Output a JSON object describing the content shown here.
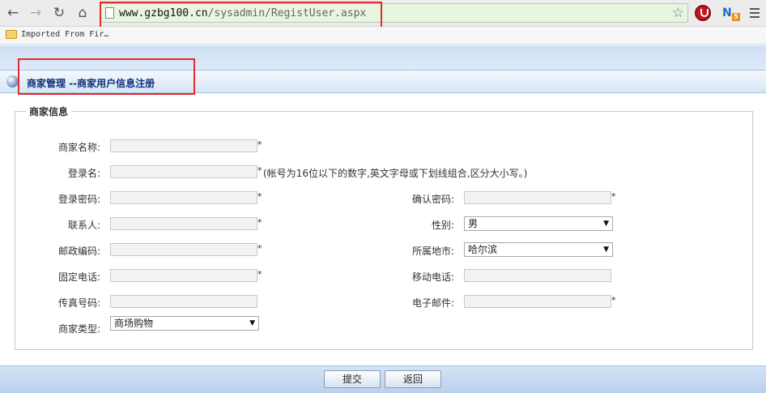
{
  "browser": {
    "url_host": "www.gzbg100.cn",
    "url_path": "/sysadmin/RegistUser.aspx",
    "bookmark_label": "Imported From Fir…",
    "back_icon": "←",
    "forward_icon": "→",
    "reload_icon": "↻",
    "home_icon": "⌂",
    "star_icon": "☆",
    "ext_badge": "5"
  },
  "page": {
    "title": "商家管理 --商家用户信息注册",
    "section_legend": "商家信息",
    "required_mark": "*",
    "select_arrow": "▼"
  },
  "form": {
    "name_label": "商家名称:",
    "login_label": "登录名:",
    "login_hint": "(帐号为16位以下的数字,英文字母或下划线组合,区分大小写。)",
    "password_label": "登录密码:",
    "confirm_label": "确认密码:",
    "contact_label": "联系人:",
    "gender_label": "性别:",
    "gender_value": "男",
    "postcode_label": "邮政编码:",
    "city_label": "所属地市:",
    "city_value": "哈尔滨",
    "phone_label": "固定电话:",
    "mobile_label": "移动电话:",
    "fax_label": "传真号码:",
    "email_label": "电子邮件:",
    "type_label": "商家类型:",
    "type_value": "商场购物"
  },
  "actions": {
    "submit_label": "提交",
    "back_label": "返回"
  }
}
